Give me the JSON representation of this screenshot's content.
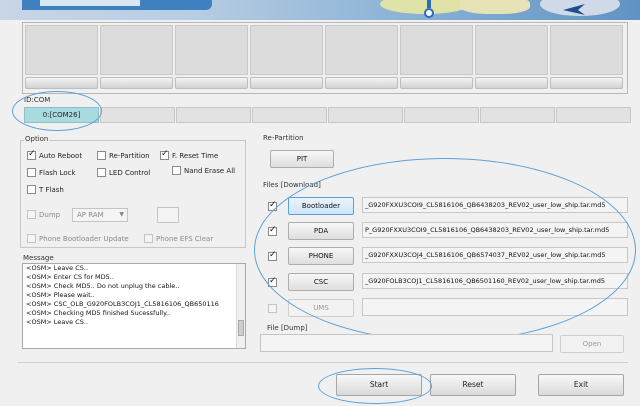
{
  "colors": {
    "accent_oval": "#5ea0d8",
    "active_com": "#a8dbe0"
  },
  "idcom": {
    "label": "ID:COM",
    "active_port": "0:[COM26]"
  },
  "option": {
    "title": "Option",
    "auto_reboot": "Auto Reboot",
    "re_partition": "Re-Partition",
    "f_reset_time": "F. Reset Time",
    "flash_lock": "Flash Lock",
    "led_control": "LED Control",
    "nand_erase_all": "Nand Erase All",
    "t_flash": "T Flash",
    "dump": "Dump",
    "dump_select": "AP RAM",
    "phone_bootloader_update": "Phone Bootloader Update",
    "phone_efs_clear": "Phone EFS Clear"
  },
  "message": {
    "title": "Message",
    "lines": [
      "<OSM> Leave CS..",
      "<OSM> Enter CS for MD5..",
      "<OSM> Check MD5.. Do not unplug the cable..",
      "<OSM> Please wait..",
      "<OSM> CSC_OLB_G920FOLB3COJ1_CL5816106_QB650116",
      "<OSM> Checking MD5 finished Sucessfully..",
      "<OSM> Leave CS.."
    ]
  },
  "repartition": {
    "title": "Re-Partition",
    "pit_label": "PIT"
  },
  "files": {
    "title": "Files [Download]",
    "rows": [
      {
        "label": "Bootloader",
        "path": "_G920FXXU3COI9_CL5816106_QB6438203_REV02_user_low_ship.tar.md5"
      },
      {
        "label": "PDA",
        "path": "P_G920FXXU3COI9_CL5816106_QB6438203_REV02_user_low_ship.tar.md5"
      },
      {
        "label": "PHONE",
        "path": "_G920FXXU3COJ4_CL5816106_QB6574037_REV02_user_low_ship.tar.md5"
      },
      {
        "label": "CSC",
        "path": "_G920FOLB3COJ1_CL5816106_QB6501160_REV02_user_low_ship.tar.md5"
      }
    ],
    "ums_label": "UMS"
  },
  "file_dump": {
    "title": "File [Dump]",
    "open_label": "Open"
  },
  "actions": {
    "start": "Start",
    "reset": "Reset",
    "exit": "Exit"
  }
}
